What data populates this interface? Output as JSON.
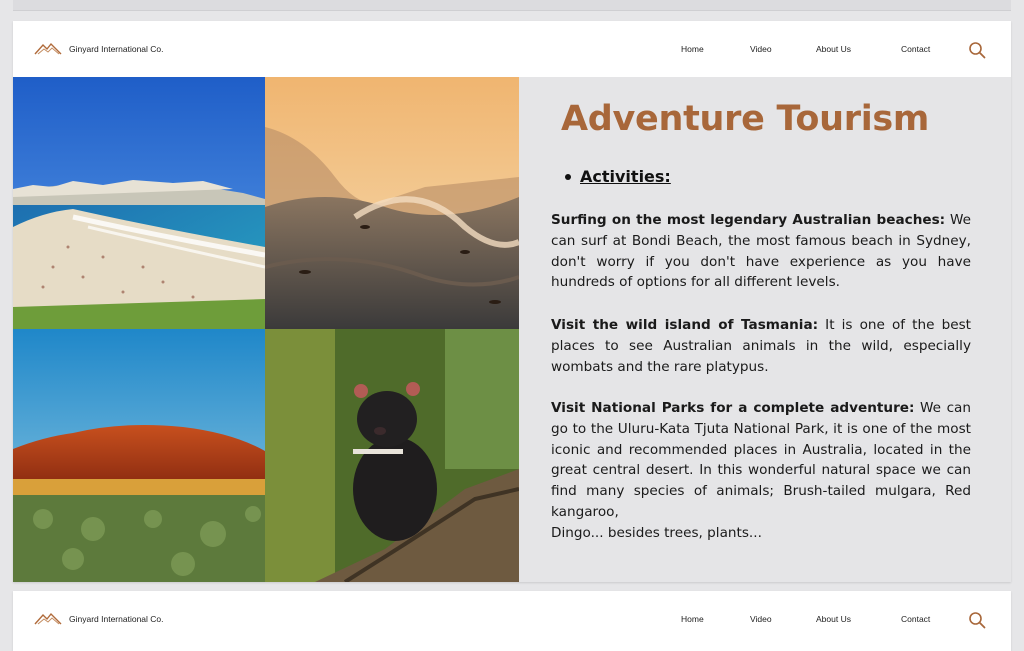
{
  "header": {
    "brand": "Ginyard International Co.",
    "nav": [
      "Home",
      "Video",
      "About Us",
      "Contact"
    ],
    "search_icon": "search-icon",
    "logo_icon": "mountain-logo-icon"
  },
  "colors": {
    "accent": "#a8673a",
    "panel_bg": "#e5e5e7"
  },
  "gallery": {
    "photos": [
      "beach",
      "ocean-waves",
      "uluru-rock",
      "tasmanian-devil"
    ]
  },
  "content": {
    "title": "Adventure Tourism",
    "bullet": "Activities:",
    "paragraphs": [
      {
        "bold": "Surfing on the most legendary Australian beaches:",
        "text": " We can surf at Bondi Beach, the most famous beach in Sydney, don't worry if you don't have experience as you have hundreds of options for all different levels."
      },
      {
        "bold": "Visit the wild island of Tasmania:",
        "text": " It is one of the best places to see Australian animals in the wild, especially wombats and the rare platypus."
      },
      {
        "bold": "Visit National Parks for a complete adventure:",
        "text": " We can go to the Uluru-Kata Tjuta National Park, it is one of the most iconic and recommended places in Australia, located in the great central desert. In this wonderful natural space we can find many species of animals; Brush-tailed mulgara, Red kangaroo,",
        "extra": "Dingo... besides trees, plants..."
      }
    ]
  }
}
